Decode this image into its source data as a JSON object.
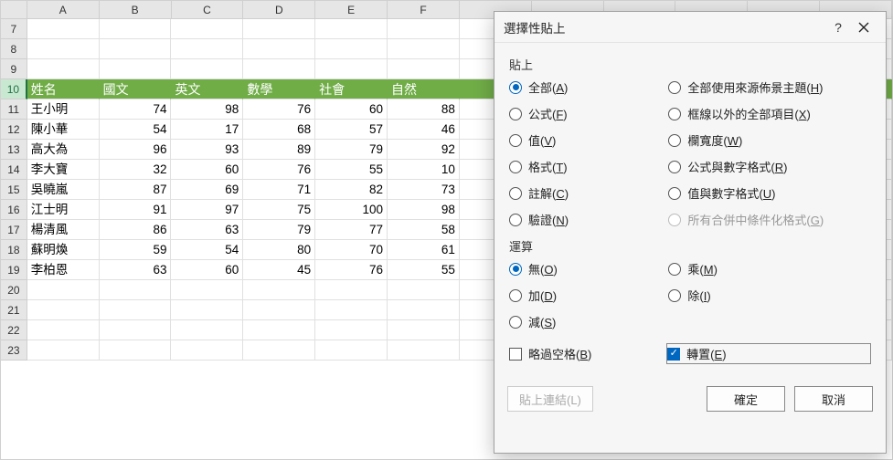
{
  "columns": [
    "A",
    "B",
    "C",
    "D",
    "E",
    "F"
  ],
  "rows": [
    7,
    8,
    9,
    10,
    11,
    12,
    13,
    14,
    15,
    16,
    17,
    18,
    19,
    20,
    21,
    22,
    23
  ],
  "header_row": 10,
  "headers": [
    "姓名",
    "國文",
    "英文",
    "數學",
    "社會",
    "自然"
  ],
  "data_rows": [
    {
      "r": 11,
      "name": "王小明",
      "v": [
        74,
        98,
        76,
        60,
        88
      ]
    },
    {
      "r": 12,
      "name": "陳小華",
      "v": [
        54,
        17,
        68,
        57,
        46
      ]
    },
    {
      "r": 13,
      "name": "高大為",
      "v": [
        96,
        93,
        89,
        79,
        92
      ]
    },
    {
      "r": 14,
      "name": "李大寶",
      "v": [
        32,
        60,
        76,
        55,
        10
      ]
    },
    {
      "r": 15,
      "name": "吳曉嵐",
      "v": [
        87,
        69,
        71,
        82,
        73
      ]
    },
    {
      "r": 16,
      "name": "江士明",
      "v": [
        91,
        97,
        75,
        100,
        98
      ]
    },
    {
      "r": 17,
      "name": "楊清風",
      "v": [
        86,
        63,
        79,
        77,
        58
      ]
    },
    {
      "r": 18,
      "name": "蘇明煥",
      "v": [
        59,
        54,
        80,
        70,
        61
      ]
    },
    {
      "r": 19,
      "name": "李柏恩",
      "v": [
        63,
        60,
        45,
        76,
        55
      ]
    }
  ],
  "dialog": {
    "title": "選擇性貼上",
    "section_paste": "貼上",
    "paste_options_left": [
      {
        "id": "all",
        "label": "全部",
        "accel": "A",
        "selected": true
      },
      {
        "id": "formulas",
        "label": "公式",
        "accel": "F"
      },
      {
        "id": "values",
        "label": "值",
        "accel": "V"
      },
      {
        "id": "formats",
        "label": "格式",
        "accel": "T"
      },
      {
        "id": "comments",
        "label": "註解",
        "accel": "C"
      },
      {
        "id": "validation",
        "label": "驗證",
        "accel": "N"
      }
    ],
    "paste_options_right": [
      {
        "id": "all-theme",
        "label": "全部使用來源佈景主題",
        "accel": "H"
      },
      {
        "id": "no-border",
        "label": "框線以外的全部項目",
        "accel": "X"
      },
      {
        "id": "col-width",
        "label": "欄寬度",
        "accel": "W"
      },
      {
        "id": "formula-num",
        "label": "公式與數字格式",
        "accel": "R"
      },
      {
        "id": "value-num",
        "label": "值與數字格式",
        "accel": "U"
      },
      {
        "id": "cond-fmt",
        "label": "所有合併中條件化格式",
        "accel": "G",
        "disabled": true
      }
    ],
    "section_op": "運算",
    "op_left": [
      {
        "id": "none",
        "label": "無",
        "accel": "O",
        "selected": true
      },
      {
        "id": "add",
        "label": "加",
        "accel": "D"
      },
      {
        "id": "sub",
        "label": "減",
        "accel": "S"
      }
    ],
    "op_right": [
      {
        "id": "mul",
        "label": "乘",
        "accel": "M"
      },
      {
        "id": "div",
        "label": "除",
        "accel": "I"
      }
    ],
    "skip_blanks": {
      "label": "略過空格",
      "accel": "B",
      "checked": false
    },
    "transpose": {
      "label": "轉置",
      "accel": "E",
      "checked": true
    },
    "paste_link": {
      "label": "貼上連結(L)",
      "disabled": true
    },
    "ok": "確定",
    "cancel": "取消"
  }
}
